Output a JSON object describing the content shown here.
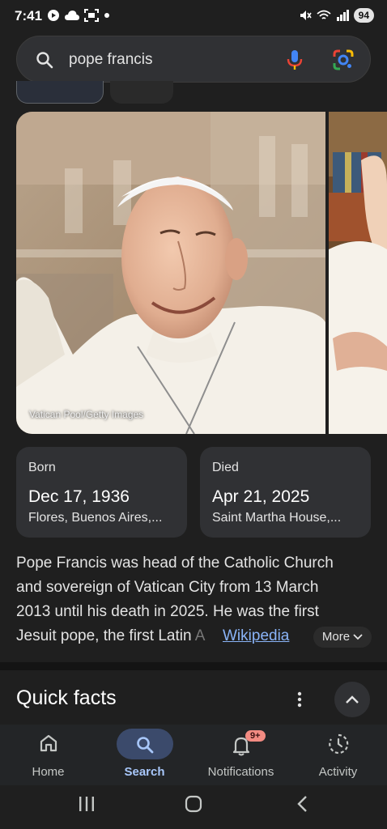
{
  "status_bar": {
    "time": "7:41",
    "battery": "94"
  },
  "search": {
    "query": "pope francis"
  },
  "image": {
    "credit": "Vatican Pool/Getty Images"
  },
  "facts": [
    {
      "label": "Born",
      "date": "Dec 17, 1936",
      "place": "Flores, Buenos Aires,..."
    },
    {
      "label": "Died",
      "date": "Apr 21, 2025",
      "place": "Saint Martha House,..."
    }
  ],
  "description": {
    "line1": "Pope Francis was head of the Catholic Church",
    "line2": "and sovereign of Vatican City from 13 March",
    "line3": "2013 until his death in 2025. He was the first",
    "line4_start": "Jesuit pope, the first Latin",
    "line4_fade": " A",
    "source": "Wikipedia",
    "more_label": "More"
  },
  "quick_facts": {
    "title": "Quick facts"
  },
  "bottom_nav": [
    {
      "label": "Home"
    },
    {
      "label": "Search"
    },
    {
      "label": "Notifications",
      "badge": "9+"
    },
    {
      "label": "Activity"
    }
  ],
  "colors": {
    "background": "#1f1f1f",
    "card": "#303134",
    "link": "#8ab4f8",
    "active_nav": "#a8c7fa"
  }
}
